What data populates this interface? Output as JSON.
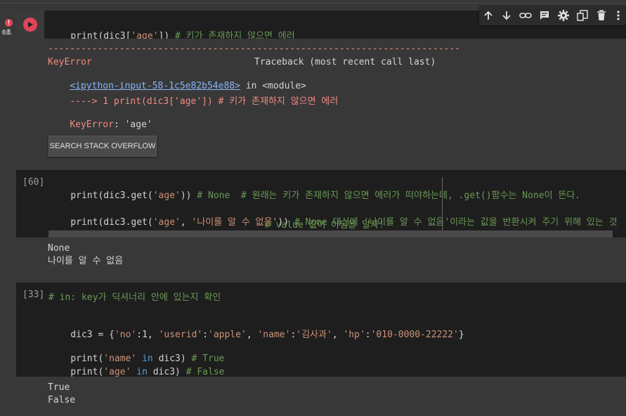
{
  "run_status": {
    "time_label": "0초"
  },
  "cell1": {
    "code": {
      "prefix": "print(dic3[",
      "string": "'age'",
      "suffix": "])",
      "comment": " # 키가 존재하지 않으면 에러"
    },
    "output": {
      "dashes": "---------------------------------------------------------------------------",
      "error_name": "KeyError",
      "traceback_label": "Traceback (most recent call last)",
      "input_link": "<ipython-input-58-1c5e82b54e88>",
      "in_module": " in <module>",
      "arrow_line": "----> 1 print(dic3['age']) # 키가 존재하지 않으면 에러",
      "final_error": "KeyError",
      "final_message": ": 'age'",
      "search_button": "SEARCH STACK OVERFLOW"
    }
  },
  "toolbar": {
    "icons": [
      "arrow-up-icon",
      "arrow-down-icon",
      "link-icon",
      "comment-icon",
      "gear-icon",
      "mirror-cell-icon",
      "trash-icon",
      "more-vert-icon"
    ]
  },
  "cell2": {
    "exec_count": "[60]",
    "line1": {
      "a": "print(dic3.get(",
      "b": "'age'",
      "c": ")) ",
      "d": "# None  # 원래는 키가 존재하지 않으면 에러가 떠야하는데, .get()함수는 None이 뜬다."
    },
    "line2": {
      "a": "print(dic3.get(",
      "b": "'age'",
      "c": ", ",
      "d": "'나이를 알 수 없음'",
      "e": ")) ",
      "f": "# None 대신에 '나이를 알 수 없음'이라는 값을 반환시켜 주기 위해 있는 것"
    },
    "line3": "# value 값이 아님을 알자!",
    "output": [
      "None",
      "나이를 알 수 없음"
    ]
  },
  "cell3": {
    "exec_count": "[33]",
    "comment_line": "# in: key가 딕셔너리 안에 있는지 확인",
    "dict_line": {
      "a": "dic3 = {",
      "p1k": "'no'",
      "p1v": ":1, ",
      "p2k": "'userid'",
      "p2c": ":",
      "p2v": "'apple'",
      "p2s": ", ",
      "p3k": "'name'",
      "p3c": ":",
      "p3v": "'김사과'",
      "p3s": ", ",
      "p4k": "'hp'",
      "p4c": ":",
      "p4v": "'010-0000-22222'",
      "p4e": "}"
    },
    "line_a": {
      "a": "print(",
      "b": "'name'",
      "c": " in ",
      "d": "dic3) ",
      "e": "# True"
    },
    "line_b": {
      "a": "print(",
      "b": "'age'",
      "c": " in ",
      "d": "dic3) ",
      "e": "# False"
    },
    "output": [
      "True",
      "False"
    ]
  },
  "colors": {
    "string": "#ce9178",
    "comment": "#6a9955",
    "keyword": "#569cd6",
    "error": "#f28b82",
    "run_button": "#e0455a"
  }
}
